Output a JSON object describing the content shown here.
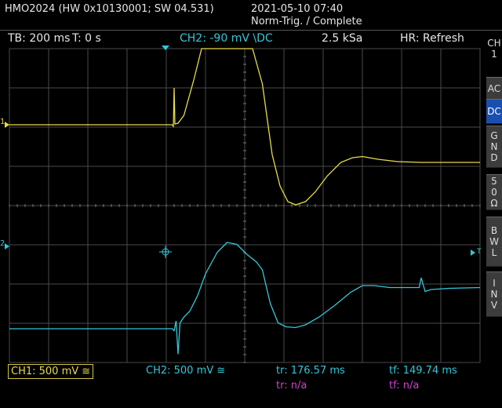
{
  "header": {
    "model": "HMO2024 (HW 0x10130001; SW 04.531)",
    "datetime": "2021-05-10 07:40",
    "trigger_status": "Norm-Trig. / Complete"
  },
  "status_bar": {
    "timebase": "TB: 200 ms",
    "trigger_time": "T: 0 s",
    "trigger_source": "CH2: -90 mV \\DC",
    "sample_rate": "2.5 kSa",
    "acq_mode": "HR: Refresh"
  },
  "side_menu": {
    "channel": "CH\n1",
    "items": [
      {
        "id": "ac",
        "label": "AC",
        "active": false
      },
      {
        "id": "dc",
        "label": "DC",
        "active": true
      },
      {
        "id": "gnd",
        "label": "GND",
        "active": false
      },
      {
        "id": "50ohm",
        "label": "50Ω",
        "active": false
      },
      {
        "id": "bwl",
        "label": "BWL",
        "active": false
      },
      {
        "id": "inv",
        "label": "INV",
        "active": false
      }
    ]
  },
  "markers": {
    "ch1": "1",
    "ch2": "2",
    "trigger_level": "T"
  },
  "footer": {
    "ch1": "CH1: 500 mV ≅",
    "ch2": "CH2: 500 mV ≅",
    "tr_ch2": "tr: 176.57 ms",
    "tf_ch2": "tf: 149.74 ms",
    "tr_ch1": "tr: n/a",
    "tf_ch1": "tf: n/a"
  },
  "colors": {
    "ch1": "#e8db4a",
    "ch2": "#34c7d8",
    "grid": "#4a4a4a",
    "measure_alt": "#d040d0"
  },
  "chart_data": {
    "type": "line",
    "grid": true,
    "x_divisions": 12,
    "y_divisions": 8,
    "series": [
      {
        "name": "CH1",
        "points": [
          [
            0,
            0.96
          ],
          [
            4.15,
            0.96
          ],
          [
            4.18,
            0.92
          ],
          [
            4.2,
            1.9
          ],
          [
            4.22,
            0.98
          ],
          [
            4.3,
            1.0
          ],
          [
            4.45,
            1.2
          ],
          [
            4.7,
            2.1
          ],
          [
            4.9,
            3.0
          ],
          [
            5.05,
            3.7
          ],
          [
            5.3,
            4.4
          ],
          [
            5.55,
            4.7
          ],
          [
            5.75,
            4.6
          ],
          [
            5.95,
            4.2
          ],
          [
            6.2,
            3.3
          ],
          [
            6.45,
            2.0
          ],
          [
            6.7,
            0.2
          ],
          [
            6.9,
            -0.6
          ],
          [
            7.1,
            -1.0
          ],
          [
            7.3,
            -1.08
          ],
          [
            7.55,
            -1.0
          ],
          [
            7.8,
            -0.75
          ],
          [
            8.1,
            -0.35
          ],
          [
            8.45,
            0.0
          ],
          [
            8.75,
            0.12
          ],
          [
            9.0,
            0.15
          ],
          [
            9.4,
            0.08
          ],
          [
            9.9,
            0.02
          ],
          [
            10.5,
            0.0
          ],
          [
            11.2,
            0.0
          ],
          [
            12,
            0.0
          ]
        ]
      },
      {
        "name": "CH2",
        "points": [
          [
            0,
            -1.05
          ],
          [
            4.15,
            -1.05
          ],
          [
            4.2,
            -1.1
          ],
          [
            4.25,
            -0.85
          ],
          [
            4.3,
            -1.7
          ],
          [
            4.35,
            -0.9
          ],
          [
            4.45,
            -0.75
          ],
          [
            4.6,
            -0.6
          ],
          [
            4.8,
            -0.2
          ],
          [
            5.0,
            0.35
          ],
          [
            5.3,
            0.9
          ],
          [
            5.55,
            1.15
          ],
          [
            5.8,
            1.1
          ],
          [
            6.05,
            0.85
          ],
          [
            6.3,
            0.65
          ],
          [
            6.45,
            0.45
          ],
          [
            6.65,
            -0.4
          ],
          [
            6.85,
            -0.9
          ],
          [
            7.05,
            -1.0
          ],
          [
            7.3,
            -1.02
          ],
          [
            7.55,
            -0.95
          ],
          [
            7.9,
            -0.75
          ],
          [
            8.3,
            -0.45
          ],
          [
            8.7,
            -0.12
          ],
          [
            9.0,
            0.05
          ],
          [
            9.3,
            0.05
          ],
          [
            9.7,
            0.0
          ],
          [
            10.2,
            0.0
          ],
          [
            10.45,
            0.0
          ],
          [
            10.5,
            0.25
          ],
          [
            10.6,
            -0.1
          ],
          [
            10.75,
            -0.05
          ],
          [
            11.2,
            -0.02
          ],
          [
            12,
            0.0
          ]
        ]
      }
    ]
  }
}
